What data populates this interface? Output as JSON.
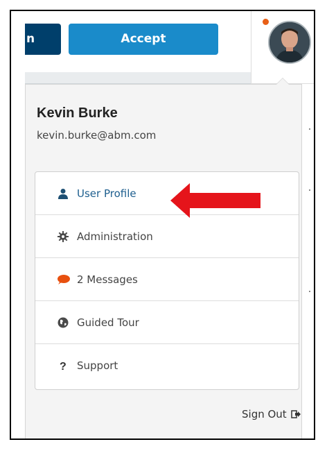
{
  "topbar": {
    "partial_button_label": "n",
    "accept_button_label": "Accept"
  },
  "user": {
    "name": "Kevin Burke",
    "email": "kevin.burke@abm.com"
  },
  "menu": {
    "items": [
      {
        "label": "User Profile",
        "icon": "user-icon",
        "active": true
      },
      {
        "label": "Administration",
        "icon": "gear-icon"
      },
      {
        "label": "2 Messages",
        "icon": "chat-bubble-icon"
      },
      {
        "label": "Guided Tour",
        "icon": "globe-icon"
      },
      {
        "label": "Support",
        "icon": "question-icon"
      }
    ]
  },
  "sign_out_label": "Sign Out",
  "colors": {
    "accept_button": "#1a8bca",
    "dark_button": "#003f6b",
    "notification_dot": "#e85f16",
    "message_icon": "#e85f16",
    "annotation_arrow": "#e5141b"
  }
}
